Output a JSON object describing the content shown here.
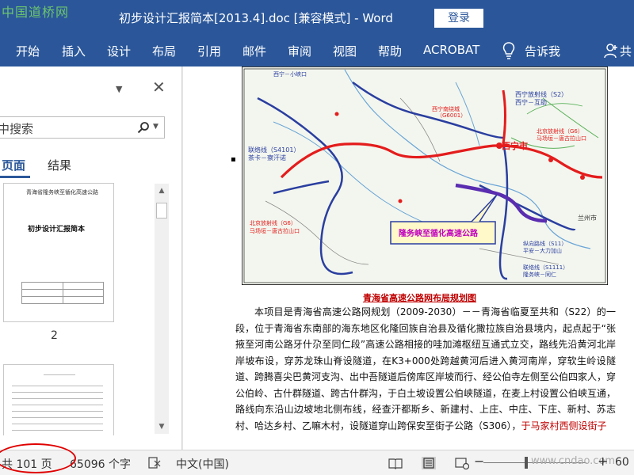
{
  "watermark_top": "中国道桥网",
  "watermark_bottom": "www.cndao.com",
  "window": {
    "title": "初步设计汇报简本[2013.4].doc [兼容模式]  -  Word",
    "login_label": "登录"
  },
  "ribbon": {
    "tabs": [
      "开始",
      "插入",
      "设计",
      "布局",
      "引用",
      "邮件",
      "审阅",
      "视图",
      "帮助",
      "ACROBAT"
    ],
    "tell_me": "告诉我",
    "share": "共"
  },
  "nav_pane": {
    "search_placeholder": "中搜索",
    "tabs": [
      "页面",
      "结果"
    ],
    "active_tab": "页面",
    "thumb1_subtitle": "青海省隆务峡至循化高速公路",
    "thumb1_title": "初步设计汇报简本",
    "page_number": "2"
  },
  "document": {
    "map_caption": "青海省高速公路网布局规划图",
    "map_labels": {
      "xining": "西宁市",
      "callout": "隆务峡至循化高速公路",
      "s22": "西宁－互助",
      "s22_code": "西宁放射线（S2）",
      "s4101": "联络线（S4101）",
      "s4101_b": "茶卡－察汗诺",
      "g6_left": "北京放射线（G6）",
      "g6_left_b": "马场垣－唐古拉山口",
      "g6_right": "北京放射线（G6）",
      "g6_right_b": "马场垣－唐古拉山口",
      "ring": "西宁南绕城",
      "ring_code": "（G6001）",
      "top": "西宁－小峡口",
      "s11": "纵向路线（S11）",
      "s11_b": "平安－大力加山",
      "s1111": "联络线（S1111）",
      "s1111_b": "隆务峡－同仁",
      "lanzhou": "兰州市"
    },
    "paragraph_main": "本项目是青海省高速公路网规划（2009-2030）－－青海省临夏至共和（S22）的一段，位于青海省东南部的海东地区化隆回族自治县及循化撒拉族自治县境内，起点起于“张掖至河南公路牙什尕至同仁段”高速公路相接的哇加滩枢纽互通式立交，路线先沿黄河北岸岸坡布设，穿苏龙珠山脊设隧道，在K3+000处跨越黄河后进入黄河南岸，穿软生岭设隧道、跨腾喜尖巴黄河支沟、出中吾隧道后傍库区岸坡而行、经公伯寺左侧至公伯四家人，穿公伯岭、古什群隧道、跨古什群沟，于白土坡设置公伯峡隧道，在麦上村设置公伯峡互通，路线向东沿山边坡地北侧布线，经查汗都斯乡、新建村、上庄、中庄、下庄、新村、苏志村、哈达乡村、乙嘛木村，设隧道穿山跨保安至街子公路（S306），",
    "paragraph_red": "于马家村西侧设街子"
  },
  "status_bar": {
    "pages": "共 101 页",
    "words": "65096 个字",
    "language": "中文(中国)",
    "zoom": "60"
  },
  "colors": {
    "accent": "#2b579a",
    "caption": "#c00000",
    "highlight_circle": "#e00000"
  }
}
